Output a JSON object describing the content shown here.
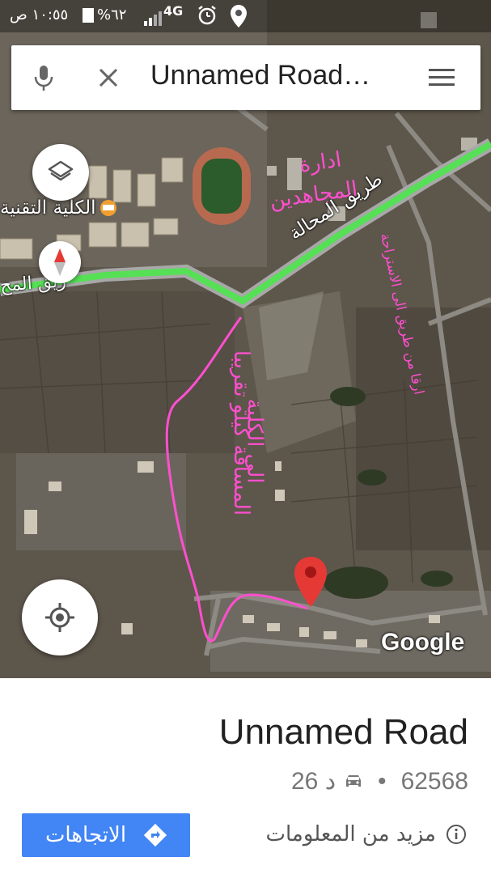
{
  "status_bar": {
    "time": "١٠:٥٥ ص",
    "battery": "%٦٢",
    "network": "4G"
  },
  "search": {
    "query": "Unnamed Road…",
    "icons": [
      "microphone-icon",
      "close-icon",
      "hamburger-menu-icon"
    ]
  },
  "map": {
    "labels": {
      "college": "الكلية التقنية",
      "road_left": "طريق المحالة",
      "road_fragment": "ريق المح",
      "google": "Google"
    },
    "annotations": {
      "admin_line1": "ادارة",
      "admin_line2": "المجاهدين",
      "distance_line1": "المسافة كيلو تقريبا",
      "distance_line2": "الى الكلية",
      "vertical_note": "ارقا من طريق الى الاستراحة"
    },
    "colors": {
      "road": "#55e055",
      "annotation": "#ff4fcf",
      "pin": "#e53935"
    },
    "controls": [
      "layers-icon",
      "compass-icon",
      "my-location-icon"
    ]
  },
  "place": {
    "title": "Unnamed Road",
    "postal_code": "62568",
    "separator": "•",
    "drive_time": "26 د",
    "directions_label": "الاتجاهات",
    "more_info_label": "مزيد من المعلومات"
  }
}
